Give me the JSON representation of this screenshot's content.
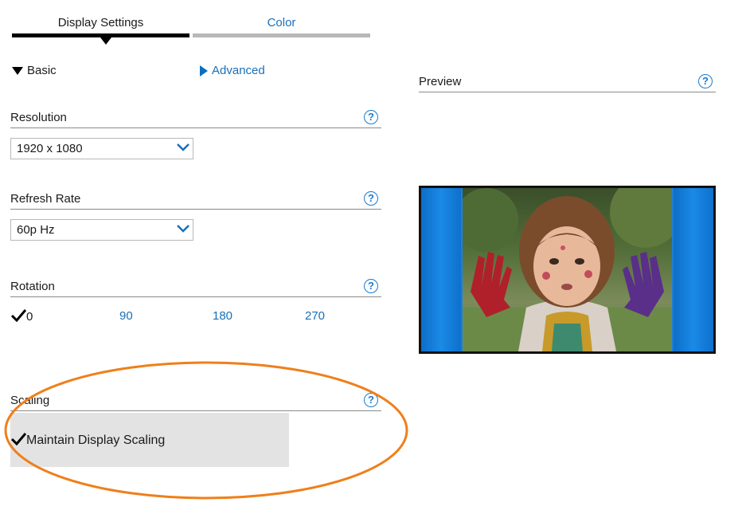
{
  "tabs": [
    {
      "label": "Display Settings",
      "active": true
    },
    {
      "label": "Color",
      "active": false
    }
  ],
  "disclosure": {
    "basic_label": "Basic",
    "advanced_label": "Advanced"
  },
  "preview": {
    "label": "Preview",
    "help": "?"
  },
  "resolution": {
    "label": "Resolution",
    "help": "?",
    "value": "1920 x 1080"
  },
  "refresh_rate": {
    "label": "Refresh Rate",
    "help": "?",
    "value": "60p Hz"
  },
  "rotation": {
    "label": "Rotation",
    "help": "?",
    "options": [
      "0",
      "90",
      "180",
      "270"
    ],
    "selected": "0"
  },
  "scaling": {
    "label": "Scaling",
    "help": "?",
    "option_label": "Maintain Display Scaling",
    "checked": true
  },
  "colors": {
    "accent": "#1a7ad0",
    "active_tab": "#000000",
    "inactive_tab": "#b8b8b8",
    "highlight_ring": "#ef7f1a",
    "selected_bg": "#e3e3e3"
  },
  "icons": {
    "help": "question-circle-icon",
    "dropdown": "chevron-down-icon",
    "check": "checkmark-icon",
    "expanded": "triangle-down-icon",
    "collapsed": "triangle-right-icon"
  }
}
